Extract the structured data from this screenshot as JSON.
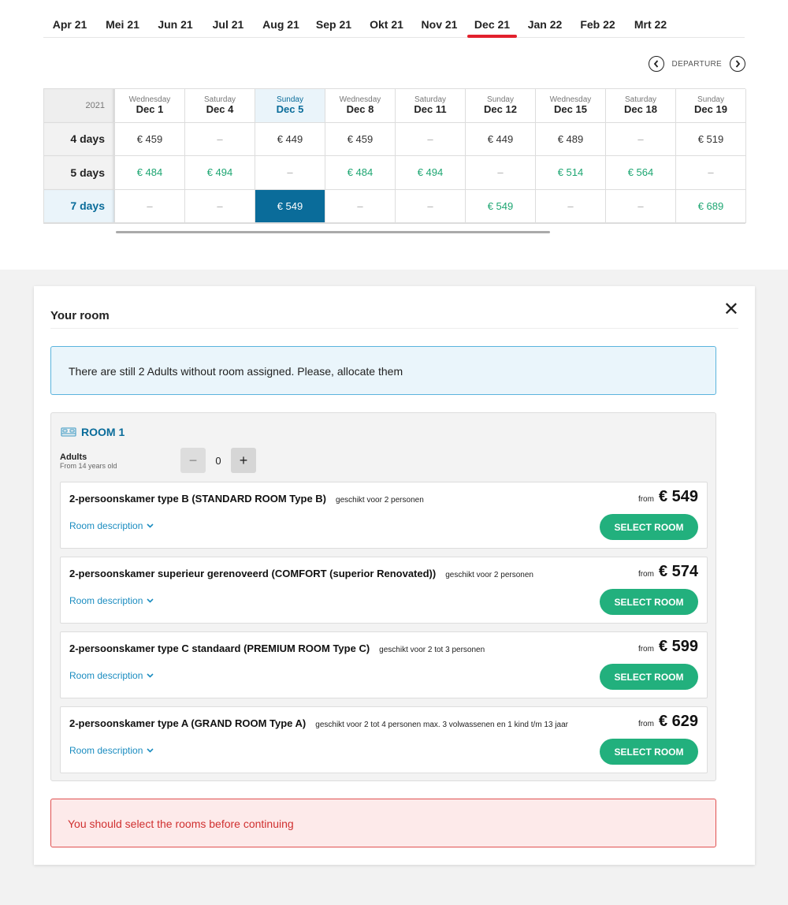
{
  "months": [
    "Apr 21",
    "Mei 21",
    "Jun 21",
    "Jul 21",
    "Aug 21",
    "Sep 21",
    "Okt 21",
    "Nov 21",
    "Dec 21",
    "Jan 22",
    "Feb 22",
    "Mrt 22"
  ],
  "active_month": "Dec 21",
  "departure_label": "DEPARTURE",
  "year": "2021",
  "dates": [
    {
      "dow": "Wednesday",
      "date": "Dec 1"
    },
    {
      "dow": "Saturday",
      "date": "Dec 4"
    },
    {
      "dow": "Sunday",
      "date": "Dec 5"
    },
    {
      "dow": "Wednesday",
      "date": "Dec 8"
    },
    {
      "dow": "Saturday",
      "date": "Dec 11"
    },
    {
      "dow": "Sunday",
      "date": "Dec 12"
    },
    {
      "dow": "Wednesday",
      "date": "Dec 15"
    },
    {
      "dow": "Saturday",
      "date": "Dec 18"
    },
    {
      "dow": "Sunday",
      "date": "Dec 19"
    }
  ],
  "selected_date": "Dec 5",
  "durations": [
    {
      "label": "4 days",
      "prices": [
        "€ 459",
        "–",
        "€ 449",
        "€ 459",
        "–",
        "€ 449",
        "€ 489",
        "–",
        "€ 519"
      ],
      "green": false
    },
    {
      "label": "5 days",
      "prices": [
        "€ 484",
        "€ 494",
        "–",
        "€ 484",
        "€ 494",
        "–",
        "€ 514",
        "€ 564",
        "–"
      ],
      "green": true
    },
    {
      "label": "7 days",
      "prices": [
        "–",
        "–",
        "€ 549",
        "–",
        "–",
        "€ 549",
        "–",
        "–",
        "€ 689"
      ],
      "green": true
    }
  ],
  "selected_duration": "7 days",
  "panel": {
    "title": "Your room",
    "info": "There are still 2 Adults without room assigned. Please, allocate them",
    "room_title": "ROOM 1",
    "adults_label": "Adults",
    "adults_sub": "From 14 years old",
    "adults_count": "0",
    "from_label": "from",
    "desc_label": "Room description",
    "select_label": "SELECT ROOM",
    "options": [
      {
        "name": "2-persoonskamer type B (STANDARD ROOM Type B)",
        "cap": "geschikt voor 2 personen",
        "price": "€ 549"
      },
      {
        "name": "2-persoonskamer superieur gerenoveerd (COMFORT (superior Renovated))",
        "cap": "geschikt voor 2 personen",
        "price": "€ 574"
      },
      {
        "name": "2-persoonskamer type C standaard (PREMIUM ROOM Type C)",
        "cap": "geschikt voor 2 tot 3 personen",
        "price": "€ 599"
      },
      {
        "name": "2-persoonskamer type A (GRAND ROOM Type A)",
        "cap": "geschikt voor 2 tot 4 personen max. 3 volwassenen en 1 kind t/m 13 jaar",
        "price": "€ 629"
      }
    ],
    "error": "You should select the rooms before continuing"
  },
  "colors": {
    "accent_red": "#e2202c",
    "primary_blue": "#0a6c9a",
    "green": "#22b07d",
    "price_green": "#1ea672"
  }
}
